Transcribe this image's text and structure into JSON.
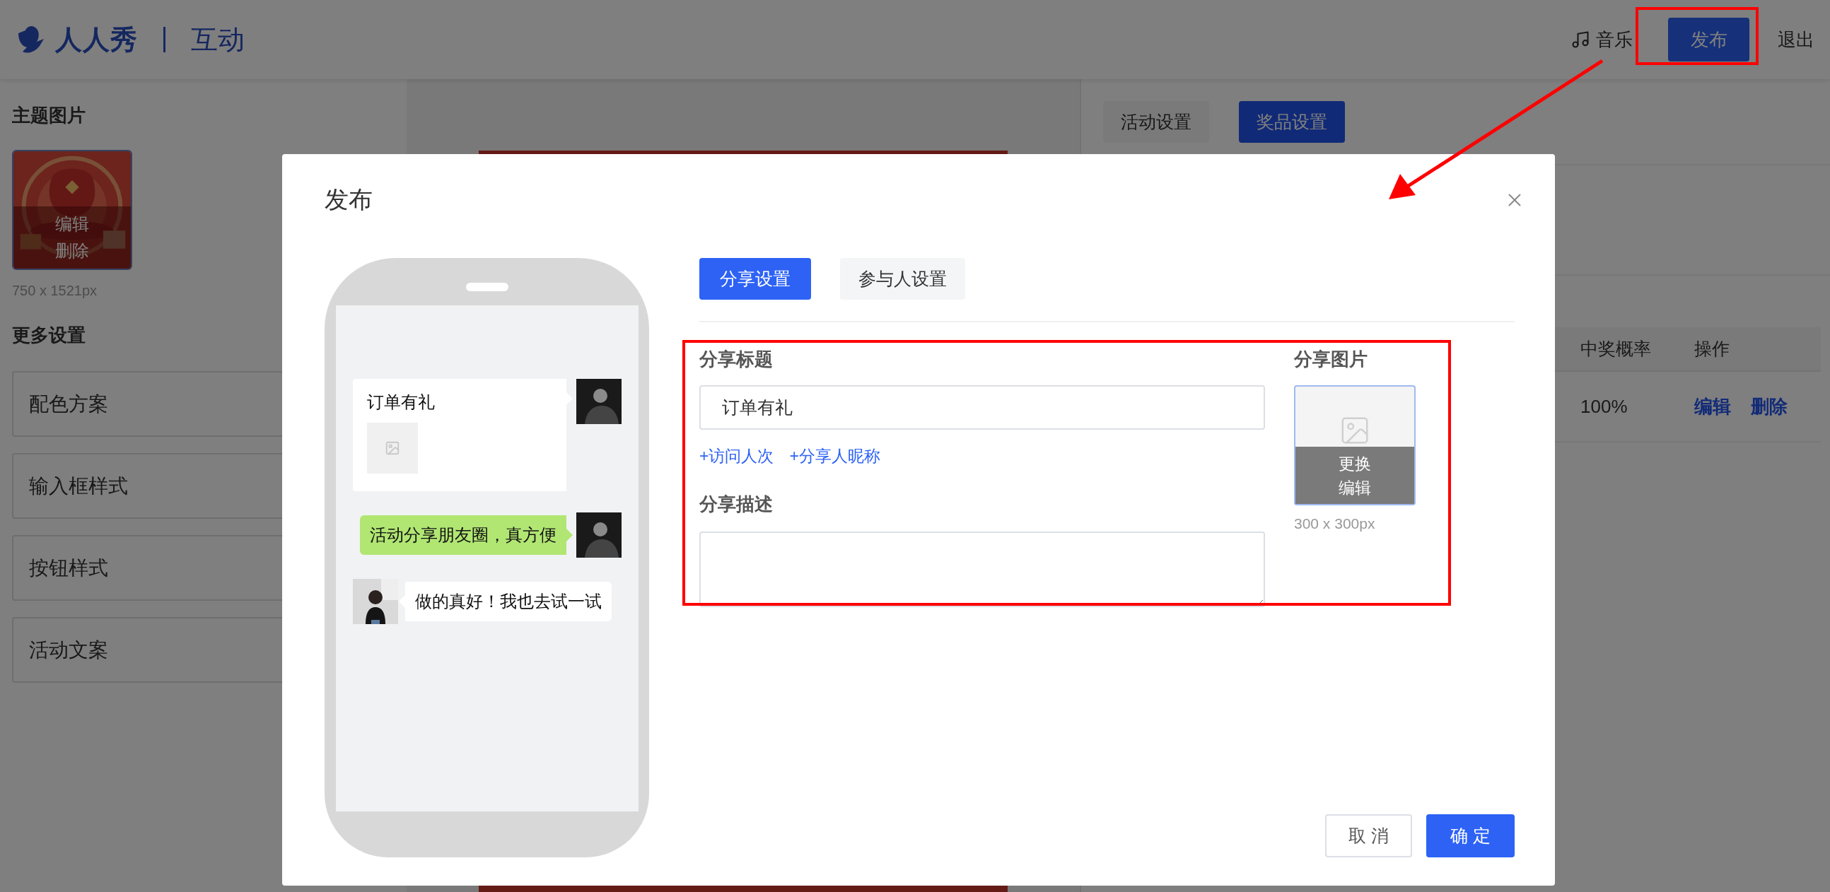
{
  "header": {
    "logo": "人人秀",
    "product": "互动",
    "music": "音乐",
    "publish": "发布",
    "exit": "退出"
  },
  "sidebar": {
    "theme_title": "主题图片",
    "thumb_actions": [
      "编辑",
      "删除"
    ],
    "thumb_size": "750 x 1521px",
    "more_title": "更多设置",
    "items": [
      "配色方案",
      "输入框样式",
      "按钮样式",
      "活动文案"
    ]
  },
  "right_panel": {
    "tabs": [
      {
        "label": "活动设置",
        "selected": false
      },
      {
        "label": "奖品设置",
        "selected": true
      }
    ],
    "table": {
      "columns": [
        "中奖概率",
        "操作"
      ],
      "rows": [
        {
          "probability": "100%",
          "actions": [
            "编辑",
            "删除"
          ]
        }
      ]
    }
  },
  "modal": {
    "title": "发布",
    "tabs": [
      {
        "label": "分享设置",
        "selected": true
      },
      {
        "label": "参与人设置",
        "selected": false
      }
    ],
    "preview": {
      "messages": [
        {
          "kind": "card",
          "outgoing": true,
          "text": "订单有礼",
          "color": "#ffffff"
        },
        {
          "kind": "bubble",
          "outgoing": true,
          "text": "活动分享朋友圈，真方便",
          "color": "#b1e673"
        },
        {
          "kind": "bubble",
          "outgoing": false,
          "text": "做的真好！我也去试一试",
          "color": "#ffffff"
        }
      ]
    },
    "share_title": {
      "label": "分享标题",
      "value": "订单有礼",
      "inserts": [
        "+访问人次",
        "+分享人昵称"
      ]
    },
    "share_desc": {
      "label": "分享描述"
    },
    "share_image": {
      "label": "分享图片",
      "actions": [
        "更换",
        "编辑"
      ],
      "size": "300 x 300px"
    },
    "buttons": [
      {
        "label": "取 消",
        "kind": "secondary"
      },
      {
        "label": "确 定",
        "kind": "primary"
      }
    ]
  }
}
